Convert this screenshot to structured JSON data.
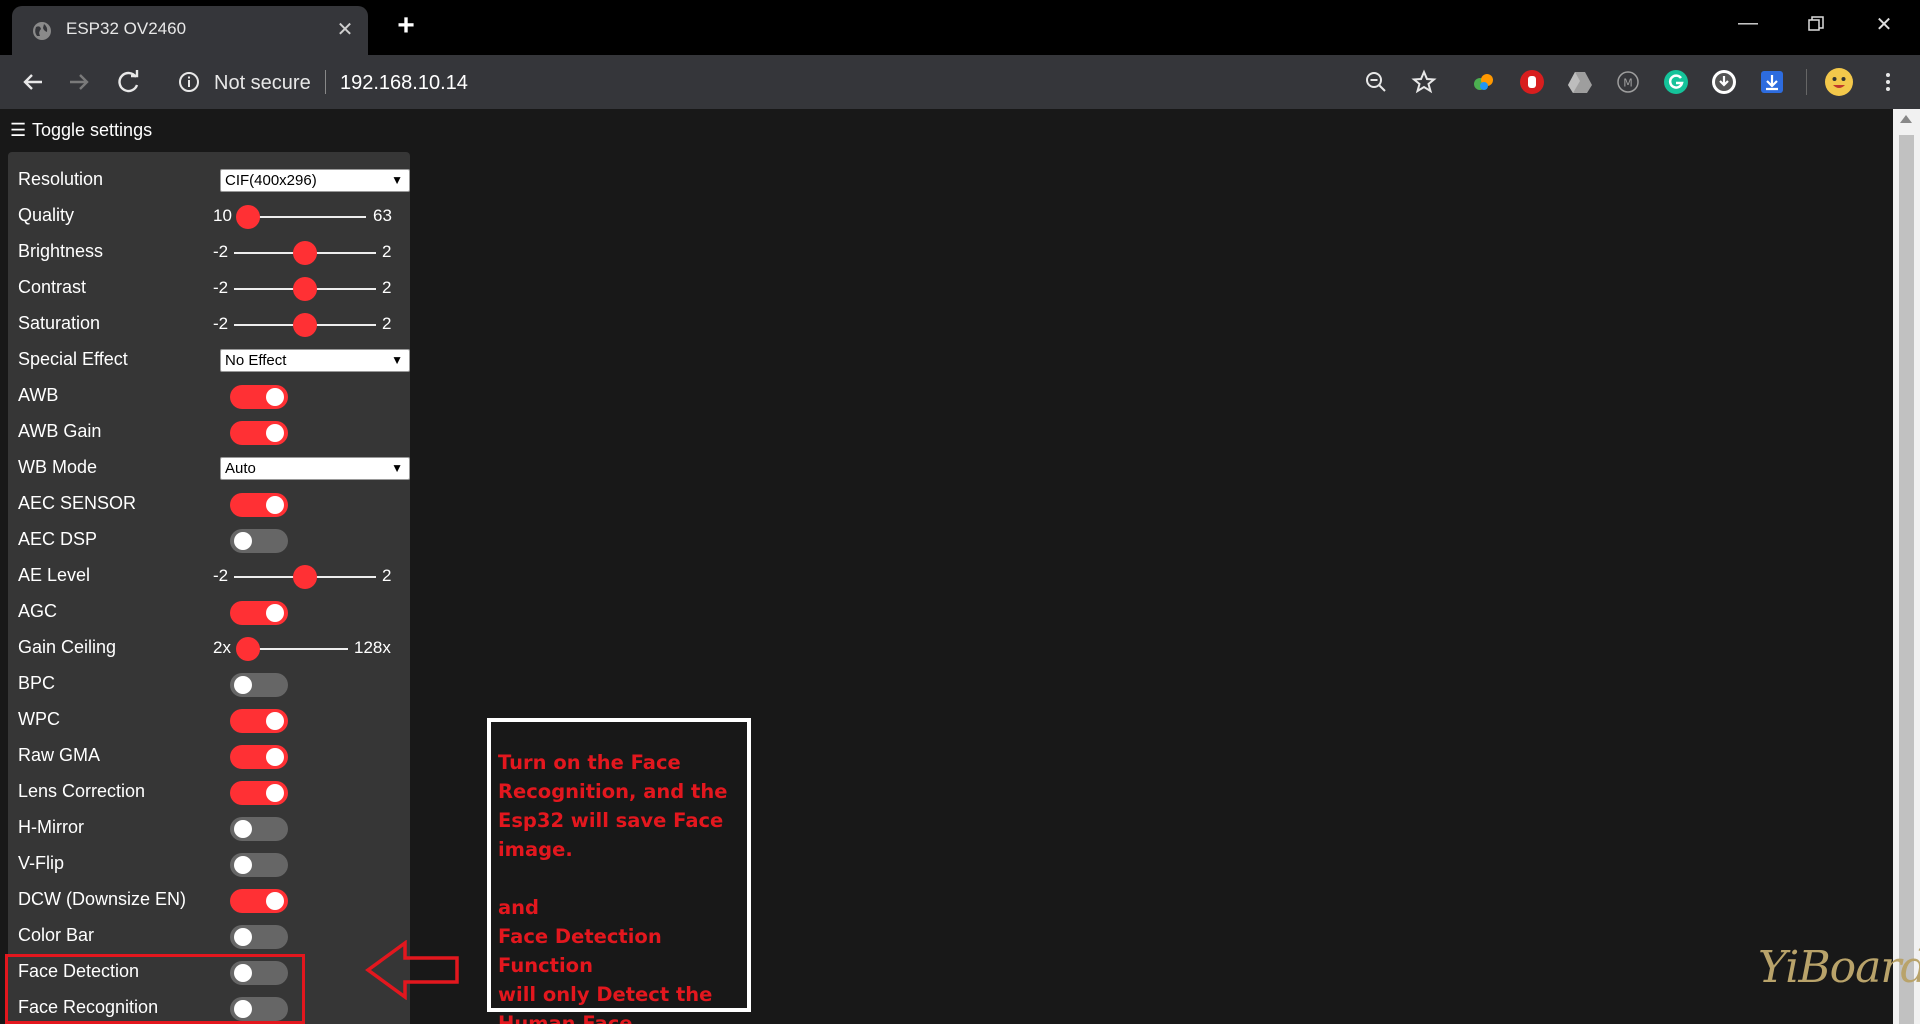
{
  "browser": {
    "tab_title": "ESP32 OV2460",
    "security_label": "Not secure",
    "url": "192.168.10.14"
  },
  "page": {
    "toggle_label": "Toggle settings"
  },
  "settings": {
    "resolution": {
      "label": "Resolution",
      "value": "CIF(400x296)"
    },
    "quality": {
      "label": "Quality",
      "min": "10",
      "max": "63",
      "level": 0.05
    },
    "brightness": {
      "label": "Brightness",
      "min": "-2",
      "max": "2",
      "level": 0.5
    },
    "contrast": {
      "label": "Contrast",
      "min": "-2",
      "max": "2",
      "level": 0.5
    },
    "saturation": {
      "label": "Saturation",
      "min": "-2",
      "max": "2",
      "level": 0.5
    },
    "special_effect": {
      "label": "Special Effect",
      "value": "No Effect"
    },
    "awb": {
      "label": "AWB",
      "on": true
    },
    "awb_gain": {
      "label": "AWB Gain",
      "on": true
    },
    "wb_mode": {
      "label": "WB Mode",
      "value": "Auto"
    },
    "aec_sensor": {
      "label": "AEC SENSOR",
      "on": true
    },
    "aec_dsp": {
      "label": "AEC DSP",
      "on": false
    },
    "ae_level": {
      "label": "AE Level",
      "min": "-2",
      "max": "2",
      "level": 0.5
    },
    "agc": {
      "label": "AGC",
      "on": true
    },
    "gain_ceiling": {
      "label": "Gain Ceiling",
      "min": "2x",
      "max": "128x",
      "level": 0.0
    },
    "bpc": {
      "label": "BPC",
      "on": false
    },
    "wpc": {
      "label": "WPC",
      "on": true
    },
    "raw_gma": {
      "label": "Raw GMA",
      "on": true
    },
    "lens_correction": {
      "label": "Lens Correction",
      "on": true
    },
    "h_mirror": {
      "label": "H-Mirror",
      "on": false
    },
    "v_flip": {
      "label": "V-Flip",
      "on": false
    },
    "dcw": {
      "label": "DCW (Downsize EN)",
      "on": true
    },
    "color_bar": {
      "label": "Color Bar",
      "on": false
    },
    "face_detection": {
      "label": "Face Detection",
      "on": false
    },
    "face_recognition": {
      "label": "Face Recognition",
      "on": false
    }
  },
  "annotation": {
    "line1": "Turn on the Face",
    "line2": "Recognition, and the",
    "line3": "Esp32 will save Face",
    "line4": "image.",
    "line5": "and",
    "line6": "Face Detection Function",
    "line7": "will only Detect the",
    "line8": "Human Face"
  },
  "watermark": "YiBoard",
  "colors": {
    "accent": "#ff3034",
    "annotation": "#e3171e",
    "panel": "#363636",
    "background": "#181818"
  }
}
